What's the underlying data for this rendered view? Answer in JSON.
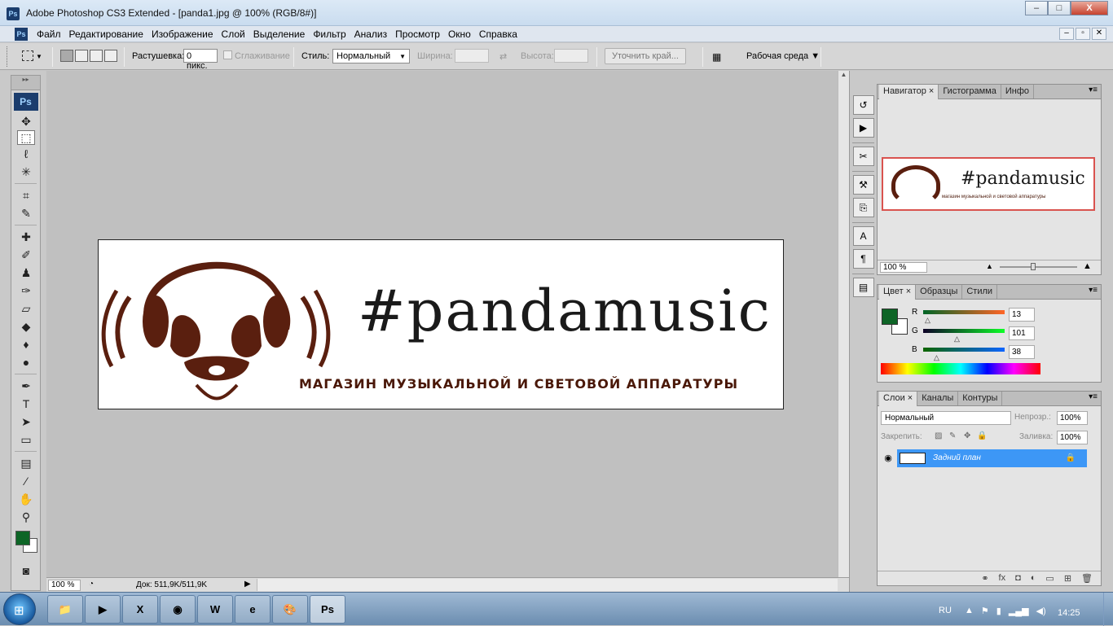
{
  "window": {
    "title": "Adobe Photoshop CS3 Extended - [panda1.jpg @ 100% (RGB/8#)]",
    "app_icon": "Ps"
  },
  "window_buttons": {
    "minimize": "–",
    "maximize": "□",
    "close": "X"
  },
  "menu": {
    "items": [
      "Файл",
      "Редактирование",
      "Изображение",
      "Слой",
      "Выделение",
      "Фильтр",
      "Анализ",
      "Просмотр",
      "Окно",
      "Справка"
    ],
    "doc_buttons": [
      "–",
      "▫",
      "✕"
    ]
  },
  "options": {
    "feather_label": "Растушевка:",
    "feather_value": "0 пикс.",
    "antialias_label": "Сглаживание",
    "style_label": "Стиль:",
    "style_value": "Нормальный",
    "width_label": "Ширина:",
    "height_label": "Высота:",
    "refine_edge": "Уточнить край...",
    "workspace": "Рабочая среда"
  },
  "toolbox": {
    "logo": "Ps",
    "grip": "▸▸",
    "tools": [
      "move-icon",
      "marquee-icon",
      "lasso-icon",
      "magic-wand-icon",
      "crop-icon",
      "slice-icon",
      "healing-icon",
      "brush-icon",
      "stamp-icon",
      "history-brush-icon",
      "eraser-icon",
      "bucket-icon",
      "blur-icon",
      "dodge-icon",
      "pen-icon",
      "type-icon",
      "path-select-icon",
      "shape-icon",
      "notes-icon",
      "eyedropper-icon",
      "hand-icon",
      "zoom-icon"
    ],
    "fg_color": "#0d6526",
    "bg_color": "#ffffff"
  },
  "document": {
    "hashtag": "#pandamusic",
    "tagline": "МАГАЗИН МУЗЫКАЛЬНОЙ И СВЕТОВОЙ АППАРАТУРЫ",
    "logo_color": "#5a1f0f",
    "text_color": "#1a1a1a"
  },
  "status": {
    "zoom": "100 %",
    "doc": "Док: 511,9K/511,9K"
  },
  "navigator": {
    "tabs": [
      "Навигатор",
      "Гистограмма",
      "Инфо"
    ],
    "zoom": "100 %",
    "thumb_text": "#pandamusic",
    "thumb_sub": "магазин музыкальной и световой аппаратуры"
  },
  "color_panel": {
    "tabs": [
      "Цвет",
      "Образцы",
      "Стили"
    ],
    "r": "13",
    "g": "101",
    "b": "38",
    "r_label": "R",
    "g_label": "G",
    "b_label": "B"
  },
  "layers": {
    "tabs": [
      "Слои",
      "Каналы",
      "Контуры"
    ],
    "blend": "Нормальный",
    "opacity_label": "Непрозр.:",
    "opacity": "100%",
    "lock_label": "Закрепить:",
    "fill_label": "Заливка:",
    "fill": "100%",
    "layer_name": "Задний план"
  },
  "taskbar": {
    "lang": "RU",
    "time": "14:25",
    "apps": [
      "folder-icon",
      "media-icon",
      "excel-icon",
      "chrome-icon",
      "word-icon",
      "ie-icon",
      "paint-icon",
      "photoshop-icon"
    ],
    "app_labels": [
      "📁",
      "▶",
      "X",
      "◉",
      "W",
      "e",
      "🎨",
      "Ps"
    ]
  }
}
